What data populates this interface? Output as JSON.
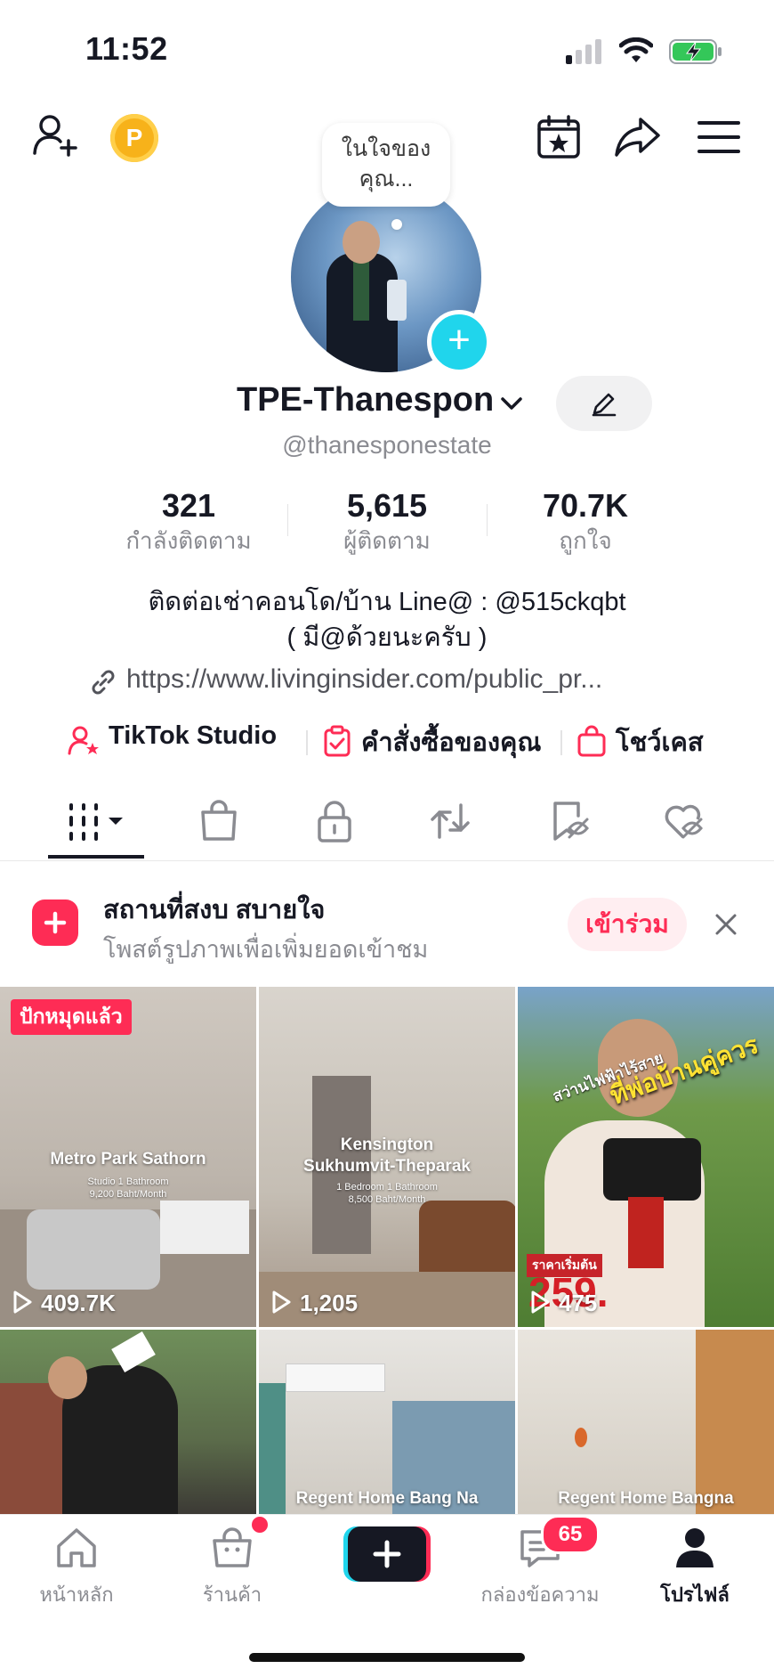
{
  "status_bar": {
    "time": "11:52"
  },
  "avatar": {
    "bubble_text_1": "ในใจของ",
    "bubble_text_2": "คุณ..."
  },
  "profile": {
    "name": "TPE-Thanespon",
    "handle": "@thanesponestate",
    "stats": [
      {
        "value": "321",
        "label": "กำลังติดตาม"
      },
      {
        "value": "5,615",
        "label": "ผู้ติดตาม"
      },
      {
        "value": "70.7K",
        "label": "ถูกใจ"
      }
    ],
    "bio_line1": "ติดต่อเช่าคอนโด/บ้าน Line@ : @515ckqbt",
    "bio_line2": "( มี@ด้วยนะครับ )",
    "link": "https://www.livinginsider.com/public_pr..."
  },
  "quick_links": [
    {
      "label": "TikTok Studio"
    },
    {
      "label": "คำสั่งซื้อของคุณ"
    },
    {
      "label": "โชว์เคส"
    }
  ],
  "promo": {
    "title": "สถานที่สงบ สบายใจ",
    "subtitle": "โพสต์รูปภาพเพื่อเพิ่มยอดเข้าชม",
    "join_label": "เข้าร่วม"
  },
  "videos": [
    {
      "pinned_label": "ปักหมุดแล้ว",
      "title": "Metro Park Sathorn",
      "sub1": "Studio 1 Bathroom",
      "sub2": "9,200 Baht/Month",
      "views": "409.7K"
    },
    {
      "title_1": "Kensington",
      "title_2": "Sukhumvit-Theparak",
      "sub1": "1 Bedroom 1 Bathroom",
      "sub2": "8,500 Baht/Month",
      "views": "1,205"
    },
    {
      "overlay_1": "สว่านไฟฟ้าไร้สาย",
      "overlay_2": "ที่พ่อบ้านคู่ควร",
      "price_label": "ราคาเริ่มต้น",
      "price": "259.",
      "views": "475"
    },
    {
      "title": ""
    },
    {
      "title": "Regent Home Bang Na"
    },
    {
      "title": "Regent Home Bangna"
    }
  ],
  "bottom_nav": {
    "items": [
      {
        "label": "หน้าหลัก"
      },
      {
        "label": "ร้านค้า"
      },
      {
        "label": "กล่องข้อความ"
      },
      {
        "label": "โปรไฟล์"
      }
    ],
    "inbox_badge": "65"
  },
  "colors": {
    "accent": "#fe2c55",
    "cyan": "#20d5ec",
    "text": "#161823",
    "muted": "#8a8b91"
  }
}
